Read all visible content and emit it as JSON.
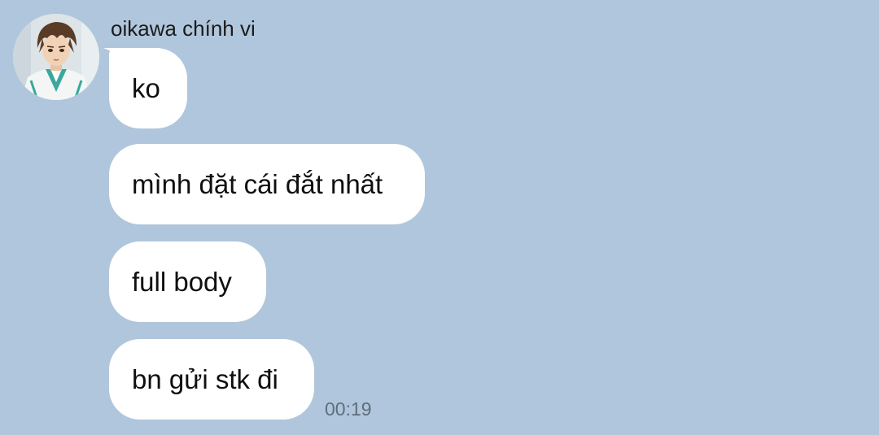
{
  "chat": {
    "sender": {
      "name": "oikawa chính vi",
      "avatar_icon": "anime-character-avatar"
    },
    "messages": [
      {
        "text": "ko"
      },
      {
        "text": "mình đặt cái đắt nhất"
      },
      {
        "text": "full body"
      },
      {
        "text": "bn gửi stk đi"
      }
    ],
    "last_message_time": "00:19"
  },
  "colors": {
    "background": "#b0c6dc",
    "bubble": "#ffffff",
    "text": "#0f0f0f",
    "timestamp": "#5f6e7c"
  }
}
